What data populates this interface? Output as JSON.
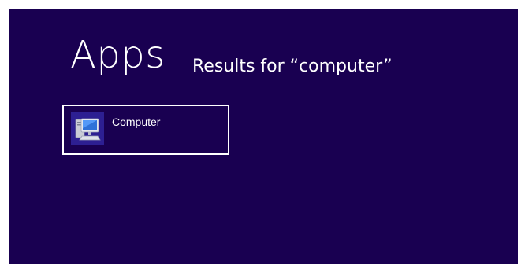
{
  "header": {
    "title": "Apps",
    "subtitle": "Results for “computer”"
  },
  "results": [
    {
      "label": "Computer",
      "icon": "computer-icon"
    }
  ],
  "colors": {
    "background": "#190051",
    "tile_icon_bg": "#2d1f92",
    "text": "#ffffff"
  }
}
